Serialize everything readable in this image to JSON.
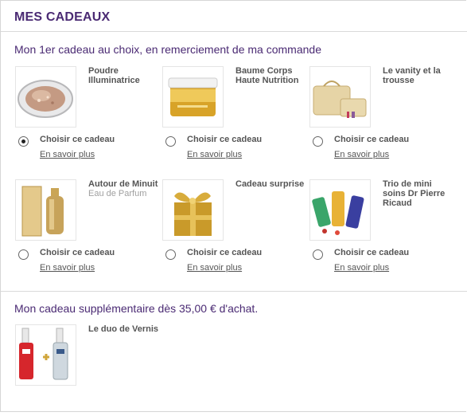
{
  "header": {
    "title": "MES CADEAUX"
  },
  "section1": {
    "title": "Mon 1er cadeau au choix, en remerciement de ma commande"
  },
  "gifts": [
    {
      "name": "Poudre Illuminatrice",
      "subtitle": "",
      "image_icon": "compact-powder-icon",
      "selected": true
    },
    {
      "name": "Baume Corps Haute Nutrition",
      "subtitle": "",
      "image_icon": "body-balm-jar-icon",
      "selected": false
    },
    {
      "name": "Le vanity et la trousse",
      "subtitle": "",
      "image_icon": "vanity-case-icon",
      "selected": false
    },
    {
      "name": "Autour de Minuit",
      "subtitle": "Eau de Parfum",
      "image_icon": "perfume-bottle-icon",
      "selected": false
    },
    {
      "name": "Cadeau surprise",
      "subtitle": "",
      "image_icon": "gift-box-icon",
      "selected": false
    },
    {
      "name": "Trio de mini soins Dr Pierre Ricaud",
      "subtitle": "",
      "image_icon": "mini-tubes-icon",
      "selected": false
    }
  ],
  "labels": {
    "choose": "Choisir ce cadeau",
    "more": "En savoir plus"
  },
  "section2": {
    "title": "Mon cadeau supplémentaire dès 35,00 € d'achat."
  },
  "extra_gift": {
    "name": "Le duo de Vernis",
    "image_icon": "nail-polish-duo-icon"
  },
  "colors": {
    "title": "#4a2a73",
    "divider": "#d9d9d9",
    "gold": "#c9a23a"
  }
}
